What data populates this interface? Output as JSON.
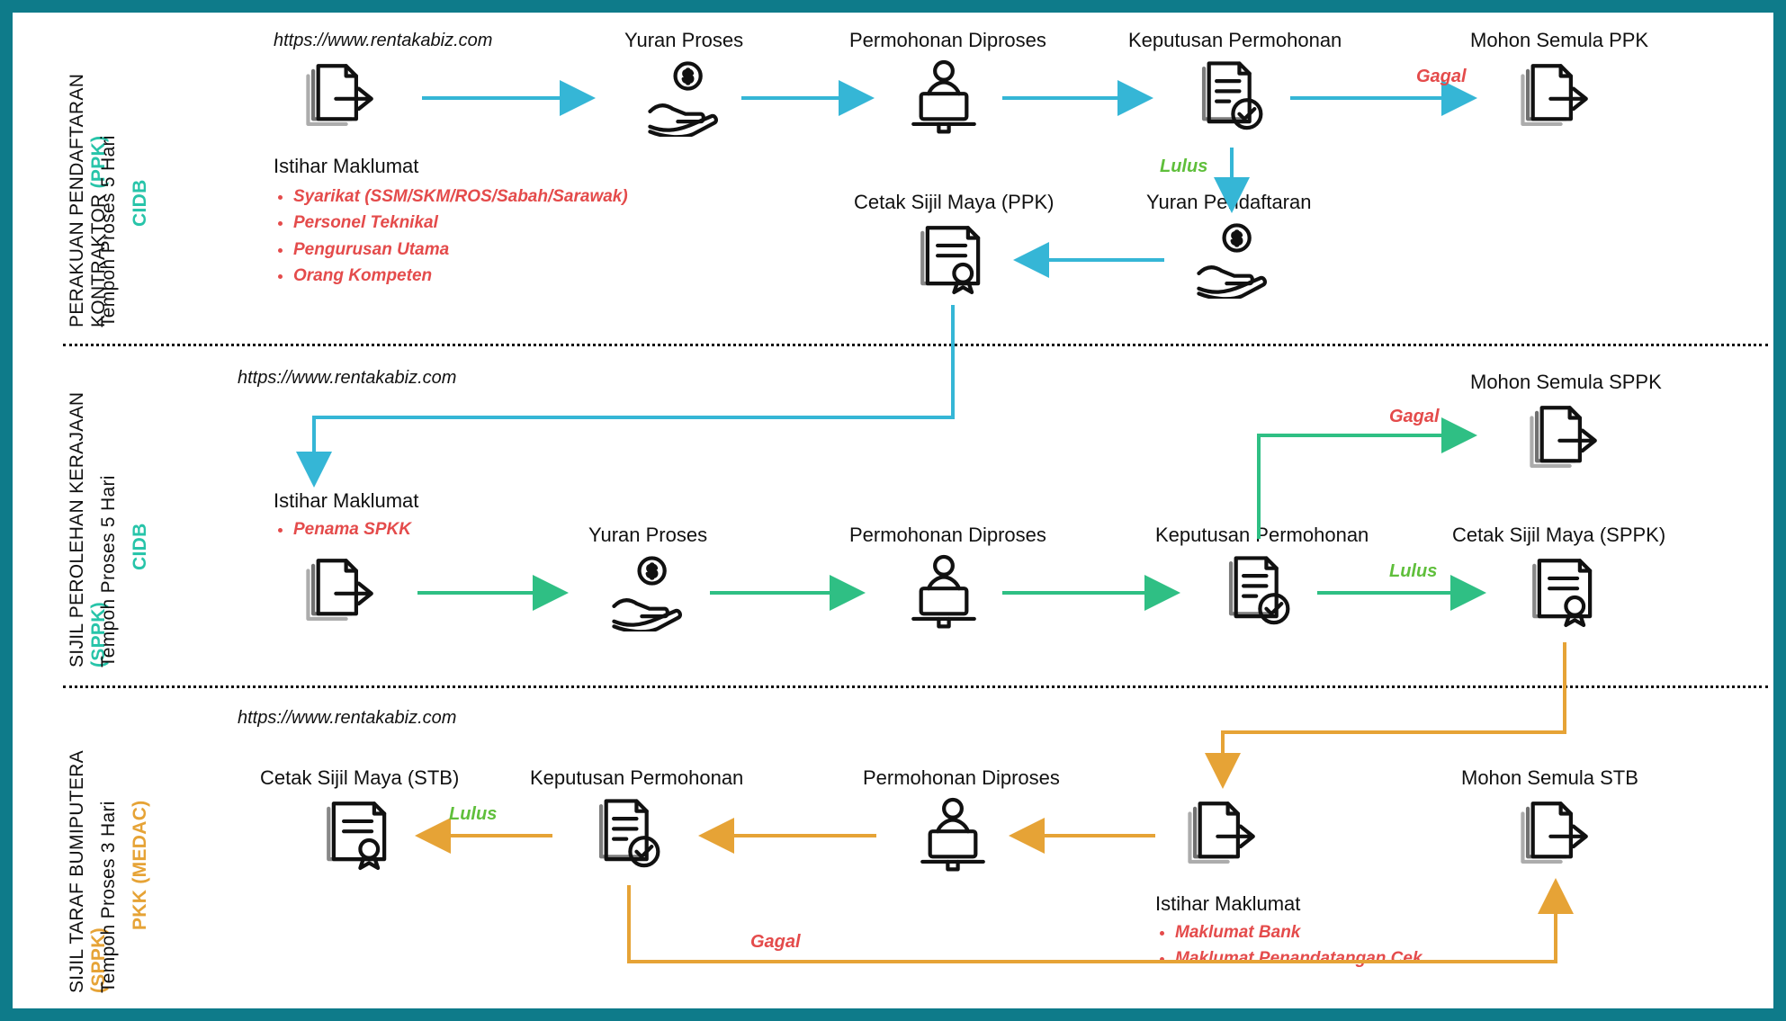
{
  "url": "https://www.rentakabiz.com",
  "status": {
    "pass": "Lulus",
    "fail": "Gagal"
  },
  "common_nodes": {
    "yuran_proses": "Yuran Proses",
    "permohonan_diproses": "Permohonan Diproses",
    "keputusan_permohonan": "Keputusan Permohonan",
    "istihar_maklumat": "Istihar Maklumat"
  },
  "sections": [
    {
      "id": "ppk",
      "title_main": "PERAKUAN PENDAFTARAN",
      "title_unit": "KONTRAKTOR",
      "title_paren": "(PPK)",
      "sub": "Tempoh Proses 5 Hari",
      "org": "CIDB",
      "org_class": "cidb",
      "bullets": [
        "Syarikat (SSM/SKM/ROS/Sabah/Sarawak)",
        "Personel Teknikal",
        "Pengurusan Utama",
        "Orang Kompeten"
      ],
      "extra_nodes": {
        "mohon_semula": "Mohon Semula PPK",
        "yuran_pendaftaran": "Yuran Pendaftaran",
        "cetak": "Cetak Sijil Maya (PPK)"
      }
    },
    {
      "id": "sppk",
      "title_main": "SIJIL PEROLEHAN",
      "title_unit": "KERAJAAN",
      "title_paren": "(SPPK)",
      "sub": "Tempoh Proses 5 Hari",
      "org": "CIDB",
      "org_class": "cidb",
      "bullets": [
        "Penama SPKK"
      ],
      "extra_nodes": {
        "mohon_semula": "Mohon Semula SPPK",
        "cetak": "Cetak Sijil Maya (SPPK)"
      }
    },
    {
      "id": "stb",
      "title_main": "SIJIL TARAF",
      "title_unit": "BUMIPUTERA",
      "title_paren": "(SPPK)",
      "sub": "Tempoh Proses 3 Hari",
      "org": "PKK (MEDAC)",
      "org_class": "pkk",
      "bullets": [
        "Maklumat Bank",
        "Maklumat Penandatangan Cek"
      ],
      "extra_nodes": {
        "mohon_semula": "Mohon Semula STB",
        "cetak": "Cetak Sijil Maya (STB)"
      }
    }
  ]
}
